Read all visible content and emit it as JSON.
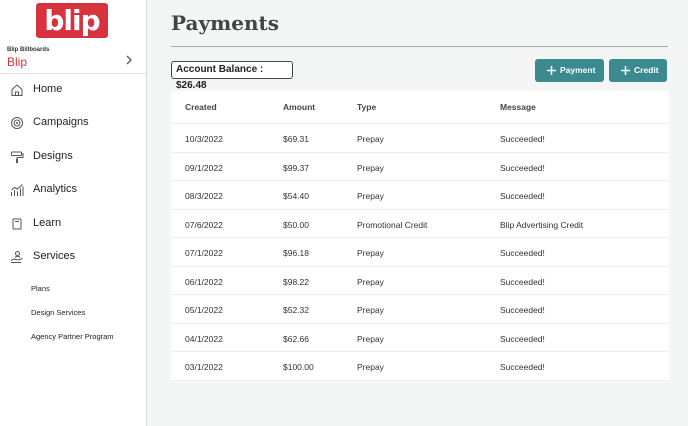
{
  "brand": {
    "logo_text": "blip",
    "org_label": "Blip Billboards",
    "org_name": "Blip",
    "accent_color": "#d8323f"
  },
  "sidebar": {
    "items": [
      {
        "label": "Home",
        "icon": "home-icon"
      },
      {
        "label": "Campaigns",
        "icon": "target-icon"
      },
      {
        "label": "Designs",
        "icon": "paint-roller-icon"
      },
      {
        "label": "Analytics",
        "icon": "chart-icon"
      },
      {
        "label": "Learn",
        "icon": "book-icon"
      },
      {
        "label": "Services",
        "icon": "hand-person-icon"
      }
    ],
    "sub_items": [
      "Plans",
      "Design Services",
      "Agency Partner Program"
    ]
  },
  "page": {
    "title": "Payments",
    "balance_text": "Account Balance  :  $26.48",
    "buttons": {
      "payment": "Payment",
      "credit": "Credit"
    },
    "button_color": "#3b8a8f"
  },
  "table": {
    "headers": [
      "Created",
      "Amount",
      "Type",
      "Message"
    ],
    "rows": [
      [
        "10/3/2022",
        "$69.31",
        "Prepay",
        "Succeeded!"
      ],
      [
        "09/1/2022",
        "$99.37",
        "Prepay",
        "Succeeded!"
      ],
      [
        "08/3/2022",
        "$54.40",
        "Prepay",
        "Succeeded!"
      ],
      [
        "07/6/2022",
        "$50.00",
        "Promotional Credit",
        "Blip Advertising Credit"
      ],
      [
        "07/1/2022",
        "$96.18",
        "Prepay",
        "Succeeded!"
      ],
      [
        "06/1/2022",
        "$98.22",
        "Prepay",
        "Succeeded!"
      ],
      [
        "05/1/2022",
        "$52.32",
        "Prepay",
        "Succeeded!"
      ],
      [
        "04/1/2022",
        "$62.66",
        "Prepay",
        "Succeeded!"
      ],
      [
        "03/1/2022",
        "$100.00",
        "Prepay",
        "Succeeded!"
      ]
    ]
  }
}
